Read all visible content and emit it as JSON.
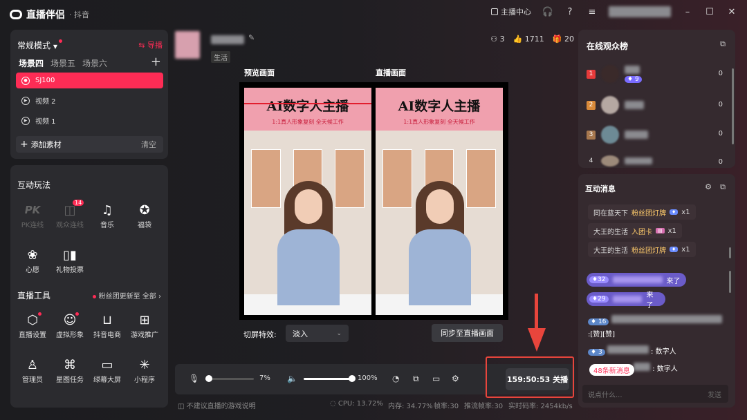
{
  "app": {
    "name": "直播伴侣",
    "sub": "· 抖音",
    "creator_center": "主播中心"
  },
  "left_top": {
    "mode": "常规模式",
    "guide": "导播",
    "scenes": [
      "场景四",
      "场景五",
      "场景六"
    ],
    "sources": [
      {
        "label": "SJ100",
        "selected": true
      },
      {
        "label": "视频 2",
        "selected": false
      },
      {
        "label": "视频 1",
        "selected": false
      }
    ],
    "add_source": "添加素材",
    "clear": "清空"
  },
  "interact": {
    "title": "互动玩法",
    "items": [
      {
        "label": "PK连线",
        "icon": "PK",
        "disabled": true
      },
      {
        "label": "观众连线",
        "icon": "camera-icon",
        "disabled": true,
        "badge": "14"
      },
      {
        "label": "音乐",
        "icon": "music-icon",
        "disabled": false
      },
      {
        "label": "福袋",
        "icon": "lucky-bag-icon",
        "disabled": false
      },
      {
        "label": "心愿",
        "icon": "wish-icon",
        "disabled": false
      },
      {
        "label": "礼物投票",
        "icon": "vote-icon",
        "disabled": false
      }
    ]
  },
  "tools": {
    "title": "直播工具",
    "fan_note": "粉丝团更新至",
    "all": "全部",
    "items": [
      {
        "label": "直播设置",
        "icon": "settings-hex-icon",
        "dot": true
      },
      {
        "label": "虚拟形象",
        "icon": "avatar-icon",
        "dot": true
      },
      {
        "label": "抖音电商",
        "icon": "cart-icon",
        "dot": false
      },
      {
        "label": "游戏推广",
        "icon": "gamepad-icon",
        "dot": false
      },
      {
        "label": "管理员",
        "icon": "admin-icon",
        "dot": false
      },
      {
        "label": "星图任务",
        "icon": "task-icon",
        "dot": false
      },
      {
        "label": "绿幕大屏",
        "icon": "screen-icon",
        "dot": false
      },
      {
        "label": "小程序",
        "icon": "miniapp-icon",
        "dot": false
      }
    ]
  },
  "header": {
    "category": "生活",
    "viewers": "3",
    "likes": "1711",
    "count": "20"
  },
  "preview": {
    "preview_label": "预览画面",
    "live_label": "直播画面",
    "banner_title": "AI数字人主播",
    "banner_sub": "1:1真人形象复刻 全天候工作"
  },
  "switch": {
    "label": "切屏特效:",
    "value": "淡入",
    "sync": "同步至直播画面"
  },
  "controls": {
    "mic_level": "7%",
    "speaker_level": "100%",
    "timer": "159:50:53",
    "stop": "关播",
    "mic_fraction": 0.07,
    "speaker_fraction": 1.0
  },
  "footer": {
    "note": "不建议直播的游戏说明",
    "cpu": "CPU: 13.72%",
    "mem": "内存: 34.77%",
    "fps": "帧率:30",
    "push_fps": "推流帧率:30",
    "bitrate": "实时码率: 2454kb/s"
  },
  "rank": {
    "title": "在线观众榜",
    "rows": [
      {
        "no": "1",
        "level": "9",
        "score": "0"
      },
      {
        "no": "2",
        "score": "0"
      },
      {
        "no": "3",
        "score": "0"
      },
      {
        "no": "4",
        "score": "0"
      }
    ]
  },
  "chat": {
    "title": "互动消息",
    "system": [
      {
        "user": "同在蓝天下",
        "text": "粉丝团灯牌",
        "count": "x1"
      },
      {
        "user": "大王的生活",
        "text": "入团卡",
        "count": "x1"
      },
      {
        "user": "大王的生活",
        "text": "粉丝团灯牌",
        "count": "x1"
      }
    ],
    "entries": [
      {
        "level": "32",
        "text": "来了"
      },
      {
        "level": "29",
        "text": "来了"
      }
    ],
    "msgs": [
      {
        "level": "16",
        "text": ":[赞][赞]"
      },
      {
        "level": "3",
        "text": ": 数字人"
      },
      {
        "text": ": 数字人"
      }
    ],
    "new_msgs": "48条新消息",
    "placeholder": "说点什么...",
    "send": "发送"
  }
}
